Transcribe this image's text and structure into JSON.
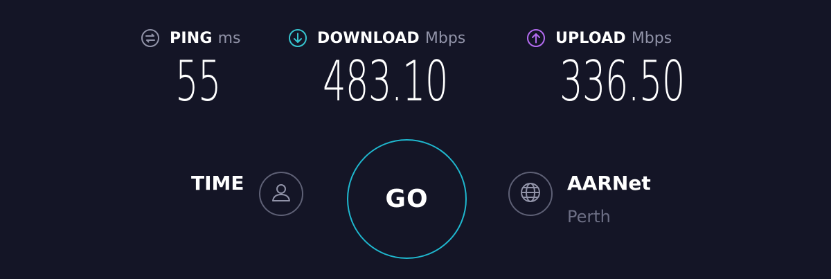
{
  "metrics": {
    "ping": {
      "label": "PING",
      "unit": "ms",
      "value": "55",
      "icon": "ping-icon",
      "color": "#9193a8"
    },
    "download": {
      "label": "DOWNLOAD",
      "unit": "Mbps",
      "value": "483.10",
      "icon": "download-arrow-icon",
      "color": "#36c4cf"
    },
    "upload": {
      "label": "UPLOAD",
      "unit": "Mbps",
      "value": "336.50",
      "icon": "upload-arrow-icon",
      "color": "#b36bf0"
    }
  },
  "time": {
    "label": "TIME",
    "icon": "user-icon"
  },
  "go_button": {
    "label": "GO",
    "ring_color": "#1fb8cf"
  },
  "server": {
    "isp": "AARNet",
    "location": "Perth",
    "icon": "globe-icon"
  },
  "colors": {
    "background": "#141526",
    "muted_text": "#9193a8",
    "icon_ring": "#5e6075"
  }
}
